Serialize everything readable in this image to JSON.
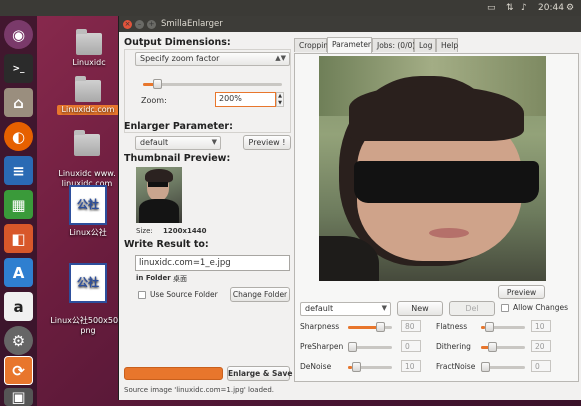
{
  "topbar": {
    "clock": "20:44"
  },
  "launcher": {
    "items": [
      "dash-home",
      "terminal",
      "files",
      "firefox",
      "writer",
      "calc",
      "impress",
      "software-center",
      "amazon",
      "system-settings",
      "smillaenlarger",
      "image-viewer"
    ]
  },
  "desktop": {
    "icons": [
      {
        "label": "Linuxidc"
      },
      {
        "label": "Linuxidc.com"
      },
      {
        "label": "Linuxidc www.\nlinuxidc.com"
      },
      {
        "label": "Linux公社",
        "badge": "公社"
      },
      {
        "label": "Linux公社500x500.\npng",
        "badge": "公社"
      }
    ]
  },
  "window": {
    "title": "SmillaEnlarger",
    "output_dimensions": {
      "heading": "Output Dimensions:",
      "mode": "Specify zoom factor",
      "zoom_label": "Zoom:",
      "zoom_value": "200%",
      "zoom_slider": 0.08
    },
    "enlarger_parameter": {
      "heading": "Enlarger Parameter:",
      "preset": "default",
      "preview_button": "Preview !"
    },
    "thumbnail": {
      "heading": "Thumbnail Preview:",
      "size_label": "Size:",
      "size_value": "1200x1440"
    },
    "write_result": {
      "heading": "Write Result to:",
      "filename": "linuxidc.com=1_e.jpg",
      "in_folder_label": "in Folder",
      "folder_value": "桌面",
      "use_source_label": "Use Source Folder",
      "use_source_checked": false,
      "change_folder_button": "Change Folder"
    },
    "progress": 0,
    "enlarge_button": "Enlarge & Save",
    "status": "Source image 'linuxidc.com=1.jpg' loaded.",
    "tabs": [
      {
        "label": "Cropping",
        "active": false
      },
      {
        "label": "Parameter",
        "active": true
      },
      {
        "label": "Jobs: (0/0)",
        "active": false
      },
      {
        "label": "Log",
        "active": false
      },
      {
        "label": "Help",
        "active": false
      }
    ],
    "preview_button": "Preview",
    "param_preset": "default",
    "new_button": "New",
    "del_button": "Del",
    "allow_changes_label": "Allow Changes",
    "params": [
      {
        "name": "Sharpness",
        "value": "80",
        "level": 0.8
      },
      {
        "name": "Flatness",
        "value": "10",
        "level": 0.1
      },
      {
        "name": "PreSharpen",
        "value": "0",
        "level": 0
      },
      {
        "name": "Dithering",
        "value": "20",
        "level": 0.2
      },
      {
        "name": "DeNoise",
        "value": "10",
        "level": 0.1
      },
      {
        "name": "FractNoise",
        "value": "0",
        "level": 0
      }
    ]
  },
  "colors": {
    "accent": "#e8762c",
    "desktop": "#6b1d3e",
    "titlebar": "#3d3c38",
    "launcher_active": "#e8762c"
  }
}
